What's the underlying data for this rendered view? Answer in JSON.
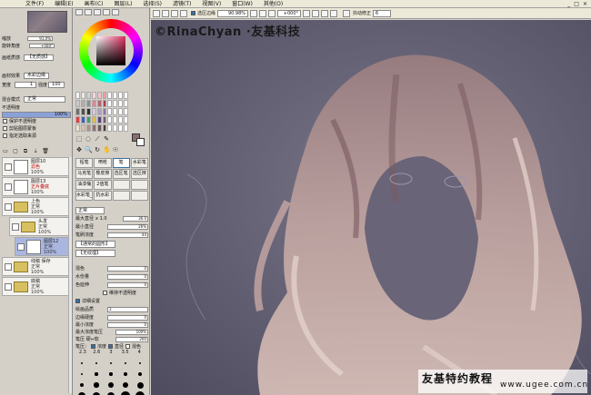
{
  "menubar": {
    "items": [
      "文件(F)",
      "编辑(E)",
      "画布(C)",
      "图层(L)",
      "选择(S)",
      "滤镜(T)",
      "视图(V)",
      "窗口(W)",
      "其他(O)"
    ],
    "controls": [
      "_",
      "□",
      "×"
    ]
  },
  "navigator": {
    "zoom_label": "缩放",
    "zoom_value": "91.0%",
    "angle_label": "旋转角度",
    "angle_value": "+000°"
  },
  "paper": {
    "texture_label": "画纸质感",
    "texture_value": "【无质感】",
    "effect_label": "画材效果",
    "effect_value": "水彩边缘",
    "width_label": "宽度",
    "width_value": "1",
    "strength_label": "强度",
    "strength_value": "100"
  },
  "layer_props": {
    "blend_label": "混合模式",
    "blend_value": "正常",
    "opacity_label": "不透明度",
    "opacity_value": "100%",
    "options": [
      {
        "label": "保护不透明度",
        "checked": false
      },
      {
        "label": "剪贴图层蒙板",
        "checked": false
      },
      {
        "label": "指定选取来源",
        "checked": false
      }
    ]
  },
  "layer_tools": [
    "▭",
    "▢",
    "⧉",
    "⇣",
    "🗑"
  ],
  "layers": [
    {
      "name": "图层10",
      "mode": "滤色",
      "opacity": "100%",
      "type": "layer",
      "indent": 0,
      "selected": false
    },
    {
      "name": "图层13",
      "mode": "正片叠底",
      "opacity": "100%",
      "type": "layer",
      "indent": 0,
      "selected": false
    },
    {
      "name": "上色",
      "mode": "正常",
      "opacity": "100%",
      "type": "folder",
      "indent": 0,
      "selected": false
    },
    {
      "name": "头发",
      "mode": "正常",
      "opacity": "100%",
      "type": "folder",
      "indent": 1,
      "selected": false
    },
    {
      "name": "图层12",
      "mode": "正常",
      "opacity": "100%",
      "type": "layer",
      "indent": 2,
      "selected": true
    },
    {
      "name": "线稿 保存",
      "mode": "正常",
      "opacity": "100%",
      "type": "folder",
      "indent": 0,
      "selected": false
    },
    {
      "name": "底稿",
      "mode": "正常",
      "opacity": "100%",
      "type": "folder",
      "indent": 0,
      "selected": false
    }
  ],
  "color": {
    "foreground": "#8a6f72",
    "background": "#ffffff",
    "swatches": [
      "#f4f4f4",
      "#e8e8e8",
      "#d0d0d0",
      "#f6d4d8",
      "#f0c0c8",
      "#e8a0a8",
      "#ffffff",
      "#ffffff",
      "#ffffff",
      "#ffffff",
      "#c8c8c8",
      "#b0b0b0",
      "#909090",
      "#e08890",
      "#c06070",
      "#a04050",
      "#ffffff",
      "#ffffff",
      "#ffffff",
      "#ffffff",
      "#707070",
      "#505050",
      "#303030",
      "#d8c8e0",
      "#b0a0c8",
      "#8878a8",
      "#ffffff",
      "#ffffff",
      "#ffffff",
      "#ffffff",
      "#e04040",
      "#4060c0",
      "#40a060",
      "#e0c040",
      "#604080",
      "#6a5f6e",
      "#ffffff",
      "#ffffff",
      "#ffffff",
      "#ffffff",
      "#f0e0d0",
      "#d8c0b0",
      "#b09080",
      "#907070",
      "#6e5a5a",
      "#4a3a3a",
      "#ffffff",
      "#ffffff",
      "#ffffff",
      "#ffffff"
    ]
  },
  "tools_row1": [
    "⬚",
    "◌",
    "⟋",
    "✎"
  ],
  "tools_row2": [
    "✥",
    "🔍",
    "↻",
    "✋",
    "☉"
  ],
  "brushes": [
    {
      "label": "铅笔",
      "selected": false
    },
    {
      "label": "喷枪",
      "selected": false
    },
    {
      "label": "笔",
      "selected": true
    },
    {
      "label": "水彩笔",
      "selected": false
    },
    {
      "label": "马克笔",
      "selected": false
    },
    {
      "label": "橡皮擦",
      "selected": false
    },
    {
      "label": "选区笔",
      "selected": false
    },
    {
      "label": "选区擦",
      "selected": false
    },
    {
      "label": "油漆桶",
      "selected": false
    },
    {
      "label": "2值笔",
      "selected": false
    },
    {
      "label": "",
      "selected": false
    },
    {
      "label": "",
      "selected": false
    },
    {
      "label": "水彩笔_水彩笔",
      "selected": false
    },
    {
      "label": "抗水彩",
      "selected": false
    },
    {
      "label": "",
      "selected": false
    },
    {
      "label": "",
      "selected": false
    }
  ],
  "brush_props": {
    "mode": "正常",
    "max_size_label": "最大直径",
    "max_size_mult": "x 1.0",
    "max_size_value": "36.0",
    "min_size_label": "最小直径",
    "min_size_value": "26%",
    "density_label": "笔刷浓度",
    "density_value": "44",
    "shape_value": "【通常的圆形】",
    "texture_value": "【无纹理】",
    "blend_label": "混色",
    "blend_value": "0",
    "water_label": "水份量",
    "water_value": "0",
    "persistence_label": "色延伸",
    "persistence_value": "0",
    "keep_opacity_label": "维持不透明度",
    "detail_label": "详细设置",
    "quality_label": "绘画品质",
    "quality_value": "3",
    "edge_label": "边缘硬度",
    "edge_value": "0",
    "min_density_label": "最小浓度",
    "min_density_value": "0",
    "max_pressure_label": "最大浓度笔压",
    "max_pressure_value": "100%",
    "pressure_label": "笔压 硬⇔软",
    "pressure_value": "200",
    "pressure_opts_label": "笔压：",
    "pressure_opts": [
      "浓度",
      "直径",
      "混色"
    ]
  },
  "size_presets": {
    "labels": [
      "2.3",
      "2.6",
      "3",
      "3.5",
      "4"
    ],
    "dots": [
      1.5,
      1.8,
      2,
      2.3,
      2.6,
      3,
      3.4,
      4,
      4.6,
      5.2,
      6,
      7,
      8,
      9,
      10,
      11,
      12,
      13,
      14,
      15
    ]
  },
  "canvas_bar": {
    "select_source_label": "选区边缘",
    "zoom_value": "90.98%",
    "angle_value": "+000°",
    "stabilizer_label": "抖动修正",
    "stabilizer_value": "6"
  },
  "canvas": {
    "watermark": "©RinaChyan ·友基科技",
    "site_title": "友基特约教程",
    "site_url": "www.ugee.com.cn",
    "bg_color": "#5f5b6e",
    "hair_color": "#b89a98"
  }
}
